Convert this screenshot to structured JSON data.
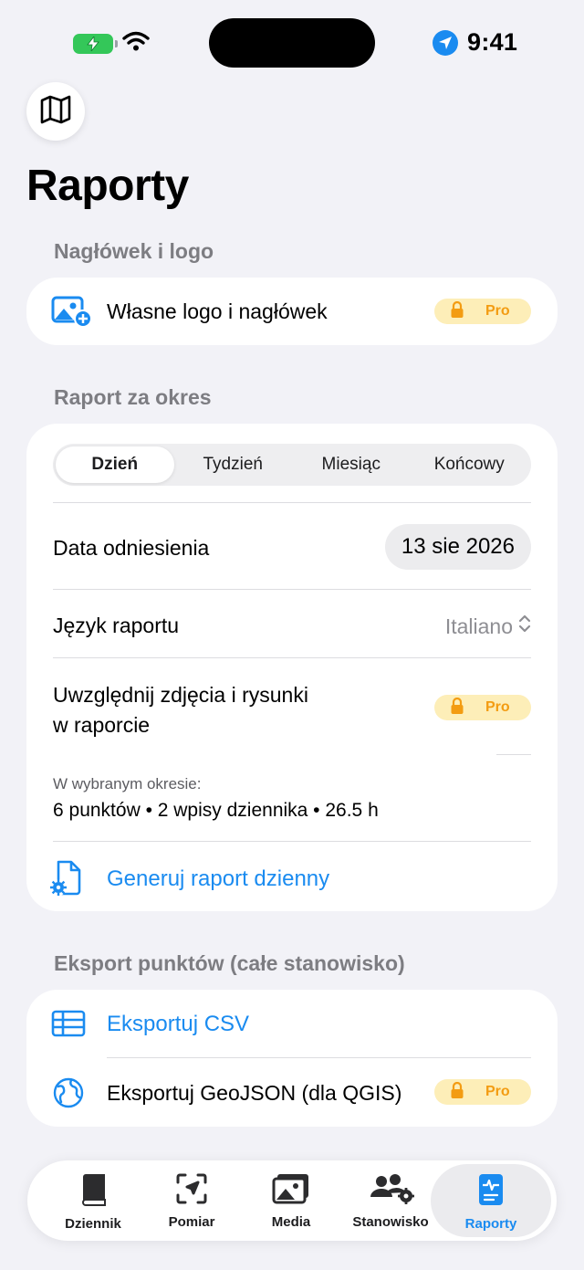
{
  "status_bar": {
    "time": "9:41"
  },
  "page": {
    "title": "Raporty"
  },
  "header_section": {
    "label": "Nagłówek i logo",
    "row_label": "Własne logo i nagłówek",
    "badge": "Pro"
  },
  "period_section": {
    "label": "Raport za okres",
    "segments": [
      "Dzień",
      "Tydzień",
      "Miesiąc",
      "Końcowy"
    ],
    "selected_segment": "Dzień",
    "reference_date_label": "Data odniesienia",
    "reference_date_value": "13 sie 2026",
    "language_label": "Język raportu",
    "language_value": "Italiano",
    "photos_label_line1": "Uwzględnij zdjęcia i rysunki",
    "photos_label_line2": "w raporcie",
    "photos_badge": "Pro",
    "summary_caption": "W wybranym okresie:",
    "summary_value": "6 punktów • 2 wpisy dziennika • 26.5 h",
    "generate_label": "Generuj raport dzienny"
  },
  "export_section": {
    "label": "Eksport punktów (całe stanowisko)",
    "csv_label": "Eksportuj CSV",
    "geojson_label": "Eksportuj GeoJSON (dla QGIS)",
    "geojson_badge": "Pro"
  },
  "tabbar": {
    "items": [
      {
        "label": "Dziennik",
        "icon": "book-icon"
      },
      {
        "label": "Pomiar",
        "icon": "measure-icon"
      },
      {
        "label": "Media",
        "icon": "photos-icon"
      },
      {
        "label": "Stanowisko",
        "icon": "team-settings-icon"
      },
      {
        "label": "Raporty",
        "icon": "report-icon"
      }
    ],
    "active": "Raporty"
  },
  "colors": {
    "accent": "#1a8bf0",
    "background": "#f2f2f7",
    "pro_badge_bg": "#fdeeb8",
    "pro_badge_fg": "#f39c12",
    "battery": "#34c759"
  }
}
